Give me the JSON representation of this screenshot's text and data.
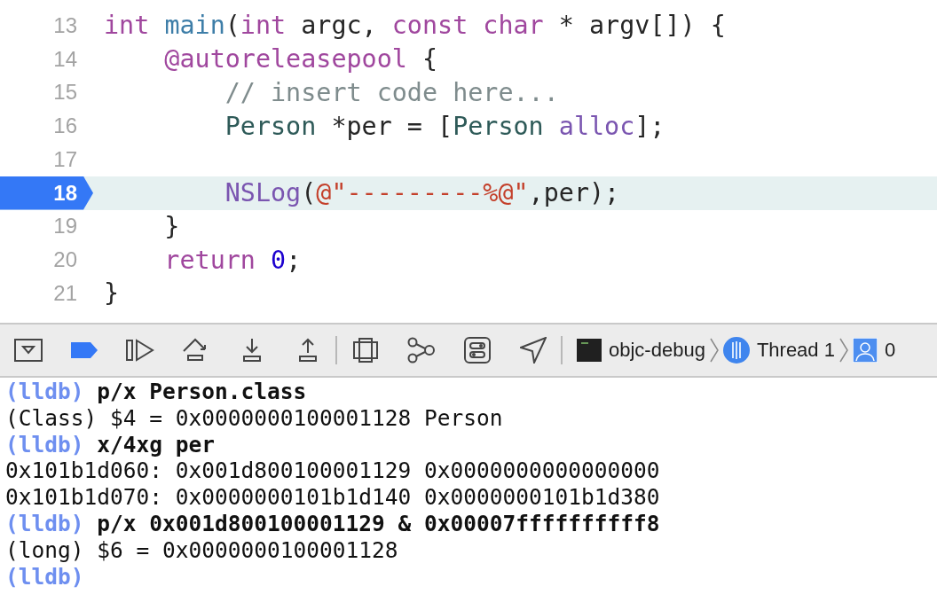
{
  "editor": {
    "lines": [
      {
        "number": "13",
        "current": false,
        "tokens": [
          {
            "kind": "keyword",
            "text": "int "
          },
          {
            "kind": "function",
            "text": "main"
          },
          {
            "kind": "plain",
            "text": "("
          },
          {
            "kind": "keyword",
            "text": "int"
          },
          {
            "kind": "plain",
            "text": " argc, "
          },
          {
            "kind": "keyword",
            "text": "const "
          },
          {
            "kind": "keyword",
            "text": "char"
          },
          {
            "kind": "plain",
            "text": " * argv[]) {"
          }
        ]
      },
      {
        "number": "14",
        "current": false,
        "tokens": [
          {
            "kind": "keyword",
            "text": "    @autoreleasepool"
          },
          {
            "kind": "plain",
            "text": " {"
          }
        ]
      },
      {
        "number": "15",
        "current": false,
        "tokens": [
          {
            "kind": "comment",
            "text": "        // insert code here..."
          }
        ]
      },
      {
        "number": "16",
        "current": false,
        "tokens": [
          {
            "kind": "type",
            "text": "        Person"
          },
          {
            "kind": "plain",
            "text": " *per = ["
          },
          {
            "kind": "type",
            "text": "Person"
          },
          {
            "kind": "method",
            "text": " alloc"
          },
          {
            "kind": "plain",
            "text": "];"
          }
        ]
      },
      {
        "number": "17",
        "current": false
      },
      {
        "number": "18",
        "current": true,
        "tokens": [
          {
            "kind": "method",
            "text": "        NSLog"
          },
          {
            "kind": "plain",
            "text": "("
          },
          {
            "kind": "string",
            "text": "@\"---------%@\""
          },
          {
            "kind": "plain",
            "text": ",per);"
          }
        ]
      },
      {
        "number": "19",
        "current": false,
        "tokens": [
          {
            "kind": "plain",
            "text": "    }"
          }
        ]
      },
      {
        "number": "20",
        "current": false,
        "tokens": [
          {
            "kind": "keyword",
            "text": "    return"
          },
          {
            "kind": "number",
            "text": " 0"
          },
          {
            "kind": "plain",
            "text": ";"
          }
        ]
      },
      {
        "number": "21",
        "current": false,
        "tokens": [
          {
            "kind": "plain",
            "text": "}"
          }
        ]
      }
    ]
  },
  "debug_bar": {
    "breakpoints_active": true,
    "path": [
      {
        "kind": "target",
        "label": "objc-debug"
      },
      {
        "kind": "thread",
        "label": "Thread 1"
      },
      {
        "kind": "frame",
        "label": "0"
      }
    ]
  },
  "console": {
    "lines": [
      {
        "kind": "command",
        "prompt": "(lldb)",
        "text": "p/x Person.class"
      },
      {
        "kind": "output",
        "text": "(Class) $4 = 0x0000000100001128 Person"
      },
      {
        "kind": "command",
        "prompt": "(lldb)",
        "text": "x/4xg per"
      },
      {
        "kind": "output",
        "text": "0x101b1d060: 0x001d800100001129 0x0000000000000000"
      },
      {
        "kind": "output",
        "text": "0x101b1d070: 0x0000000101b1d140 0x0000000101b1d380"
      },
      {
        "kind": "command",
        "prompt": "(lldb)",
        "text": "p/x 0x001d800100001129 & 0x00007ffffffffff8"
      },
      {
        "kind": "output",
        "text": "(long) $6 = 0x0000000100001128"
      },
      {
        "kind": "command",
        "prompt": "(lldb)"
      }
    ]
  }
}
